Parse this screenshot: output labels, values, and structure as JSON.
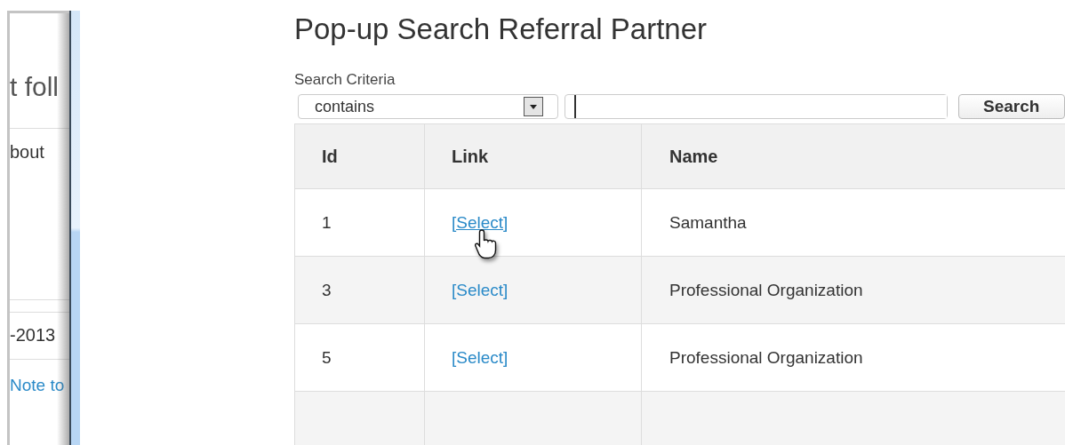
{
  "background_page": {
    "heading": "t foll",
    "text": "bout",
    "date": "-2013",
    "link": "Note to"
  },
  "popup": {
    "title": "Pop-up Search Referral Partner",
    "search": {
      "label": "Search Criteria",
      "operator": "contains",
      "button": "Search"
    },
    "table": {
      "columns": [
        "Id",
        "Link",
        "Name"
      ],
      "rows": [
        {
          "id": "1",
          "link": "[Select]",
          "hovered": true,
          "name": "Samantha"
        },
        {
          "id": "3",
          "link": "[Select]",
          "hovered": false,
          "name": "Professional Organization"
        },
        {
          "id": "5",
          "link": "[Select]",
          "hovered": false,
          "name": "Professional Organization"
        }
      ]
    }
  }
}
